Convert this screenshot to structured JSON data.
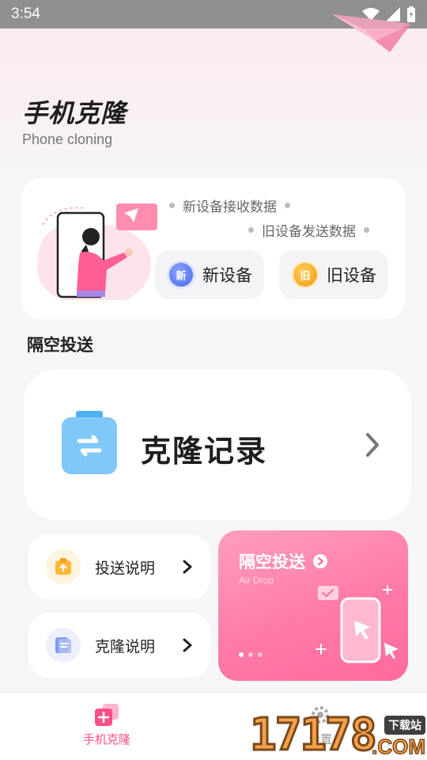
{
  "status_bar": {
    "time": "3:54"
  },
  "header": {
    "title": "手机克隆",
    "subtitle": "Phone cloning"
  },
  "device_card": {
    "hint_new": "新设备接收数据",
    "hint_old": "旧设备发送数据",
    "new_device": {
      "badge": "新",
      "label": "新设备"
    },
    "old_device": {
      "badge": "旧",
      "label": "旧设备"
    }
  },
  "section": {
    "title": "隔空投送"
  },
  "clone_record": {
    "label": "克隆记录"
  },
  "help_items": [
    {
      "label": "投送说明"
    },
    {
      "label": "克隆说明"
    }
  ],
  "airdrop_card": {
    "title": "隔空投送",
    "subtitle": "Air Drop"
  },
  "bottom_nav": {
    "items": [
      {
        "label": "手机克隆",
        "active": true
      },
      {
        "label": "设置",
        "active": false
      }
    ]
  },
  "watermark": {
    "number": "17178",
    "tag": "下载站",
    "suffix": ".COM"
  },
  "colors": {
    "accent": "#ff4d86",
    "airdrop_gradient_start": "#ff9ebe",
    "airdrop_gradient_end": "#ff6a9d",
    "new_badge": "#4a66ea",
    "old_badge": "#f39a12",
    "clone_icon": "#7fc8f8"
  },
  "icons": {
    "status": [
      "wifi-icon",
      "signal-icon",
      "battery-icon"
    ],
    "clone_record": "clone-transfer-icon",
    "help_1": "upload-box-icon",
    "help_2": "document-icon",
    "airdrop": "play-circle-icon",
    "nav_clone": "clone-add-icon",
    "nav_settings": "gear-icon"
  }
}
